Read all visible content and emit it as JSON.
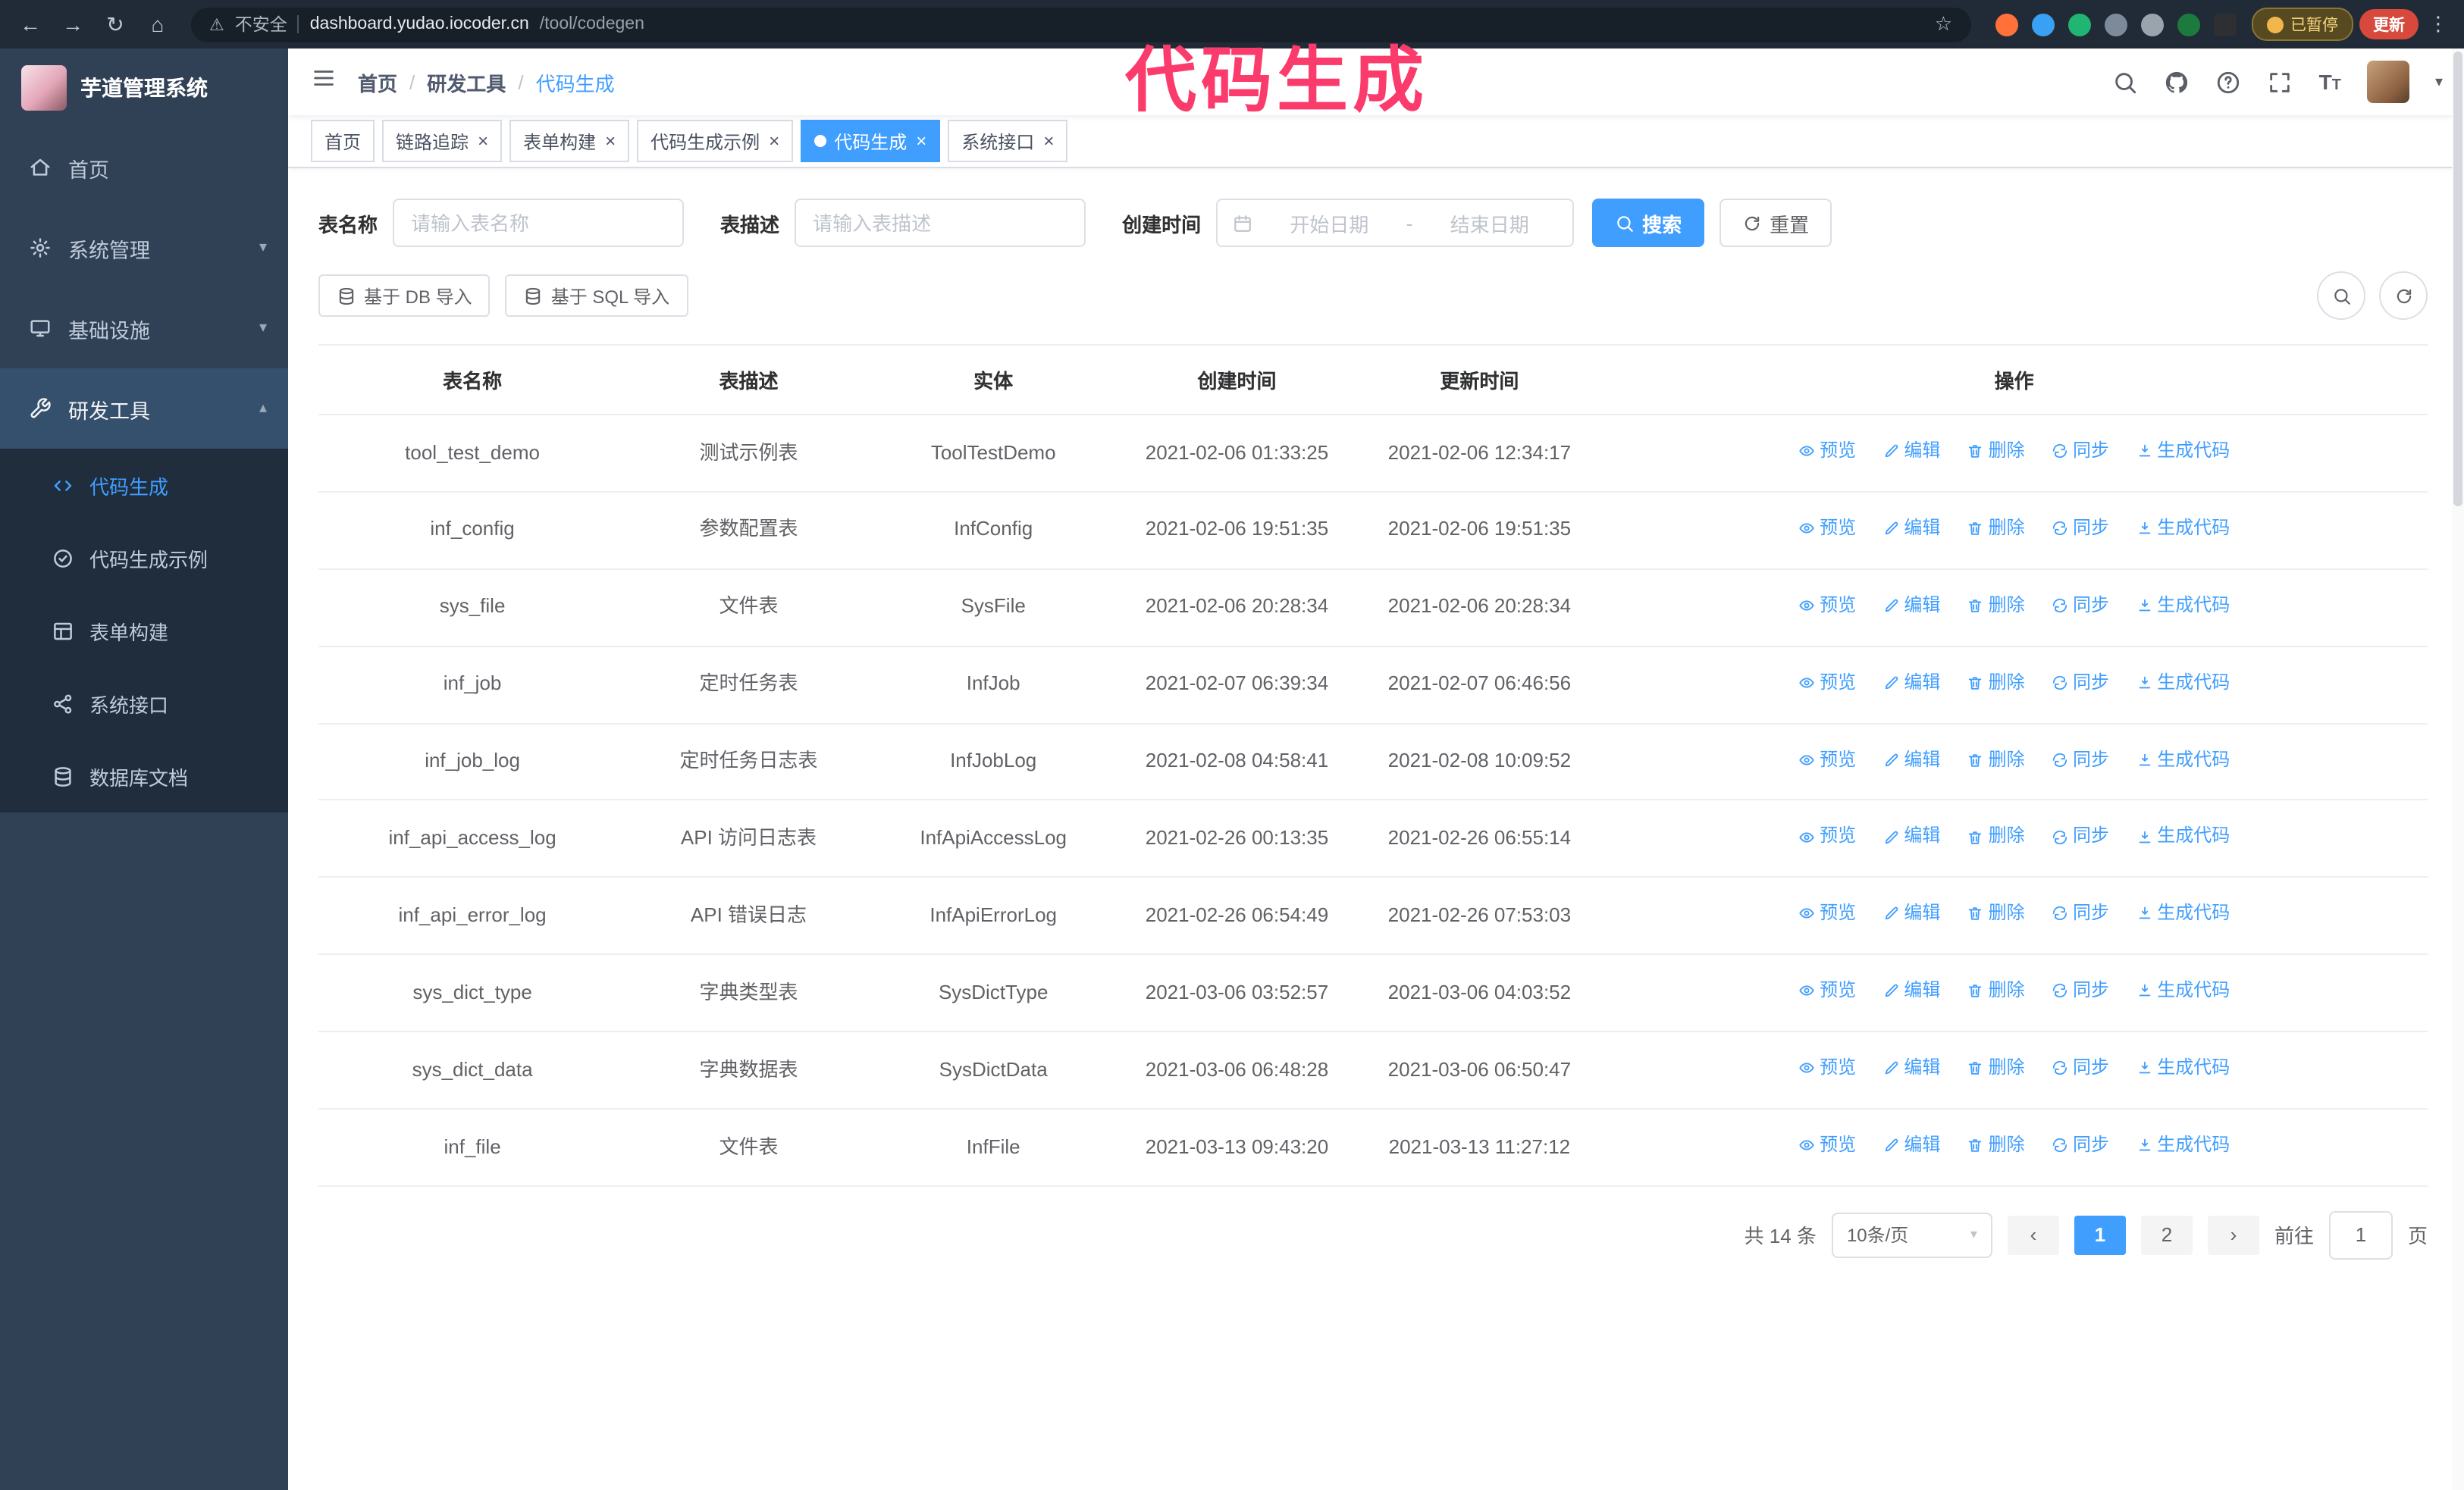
{
  "annotation": {
    "text": "代码生成"
  },
  "colors": {
    "primary": "#409eff",
    "annotation_pink": "#fb3b6c",
    "sidebar_bg": "#304156",
    "submenu_bg": "#1f2d3d"
  },
  "ui": {
    "close_glyph": "×",
    "chevron_down": "▾",
    "chevron_up": "▴",
    "caret_down": "▾",
    "font_icon_large": "T",
    "font_icon_small": "T"
  },
  "browser": {
    "back_glyph": "←",
    "forward_glyph": "→",
    "reload_glyph": "↻",
    "home_glyph": "⌂",
    "warning_glyph": "⚠",
    "security_label": "不安全",
    "url_host": "dashboard.yudao.iocoder.cn",
    "url_path": "/tool/codegen",
    "star_glyph": "☆",
    "paused_badge": "已暂停",
    "update_button": "更新",
    "overflow_glyph": "⋮"
  },
  "sidebar": {
    "logo_title": "芋道管理系统",
    "items": [
      {
        "label": "首页"
      },
      {
        "label": "系统管理"
      },
      {
        "label": "基础设施"
      },
      {
        "label": "研发工具"
      }
    ],
    "submenu": [
      {
        "label": "代码生成"
      },
      {
        "label": "代码生成示例"
      },
      {
        "label": "表单构建"
      },
      {
        "label": "系统接口"
      },
      {
        "label": "数据库文档"
      }
    ]
  },
  "header": {
    "breadcrumb": [
      "首页",
      "研发工具",
      "代码生成"
    ],
    "separator": "/"
  },
  "tabs": [
    {
      "label": "首页"
    },
    {
      "label": "链路追踪"
    },
    {
      "label": "表单构建"
    },
    {
      "label": "代码生成示例"
    },
    {
      "label": "代码生成"
    },
    {
      "label": "系统接口"
    }
  ],
  "filters": {
    "table_name_label": "表名称",
    "table_name_placeholder": "请输入表名称",
    "table_desc_label": "表描述",
    "table_desc_placeholder": "请输入表描述",
    "create_time_label": "创建时间",
    "date_start_placeholder": "开始日期",
    "date_separator": "-",
    "date_end_placeholder": "结束日期",
    "search_button": "搜索",
    "reset_button": "重置"
  },
  "toolbar": {
    "import_db": "基于 DB 导入",
    "import_sql": "基于 SQL 导入"
  },
  "table": {
    "columns": [
      "表名称",
      "表描述",
      "实体",
      "创建时间",
      "更新时间",
      "操作"
    ],
    "actions": [
      "预览",
      "编辑",
      "删除",
      "同步",
      "生成代码"
    ],
    "rows": [
      [
        "tool_test_demo",
        "测试示例表",
        "ToolTestDemo",
        "2021-02-06 01:33:25",
        "2021-02-06 12:34:17"
      ],
      [
        "inf_config",
        "参数配置表",
        "InfConfig",
        "2021-02-06 19:51:35",
        "2021-02-06 19:51:35"
      ],
      [
        "sys_file",
        "文件表",
        "SysFile",
        "2021-02-06 20:28:34",
        "2021-02-06 20:28:34"
      ],
      [
        "inf_job",
        "定时任务表",
        "InfJob",
        "2021-02-07 06:39:34",
        "2021-02-07 06:46:56"
      ],
      [
        "inf_job_log",
        "定时任务日志表",
        "InfJobLog",
        "2021-02-08 04:58:41",
        "2021-02-08 10:09:52"
      ],
      [
        "inf_api_access_log",
        "API 访问日志表",
        "InfApiAccessLog",
        "2021-02-26 00:13:35",
        "2021-02-26 06:55:14"
      ],
      [
        "inf_api_error_log",
        "API 错误日志",
        "InfApiErrorLog",
        "2021-02-26 06:54:49",
        "2021-02-26 07:53:03"
      ],
      [
        "sys_dict_type",
        "字典类型表",
        "SysDictType",
        "2021-03-06 03:52:57",
        "2021-03-06 04:03:52"
      ],
      [
        "sys_dict_data",
        "字典数据表",
        "SysDictData",
        "2021-03-06 06:48:28",
        "2021-03-06 06:50:47"
      ],
      [
        "inf_file",
        "文件表",
        "InfFile",
        "2021-03-13 09:43:20",
        "2021-03-13 11:27:12"
      ]
    ]
  },
  "pagination": {
    "total": "共 14 条",
    "page_size": "10条/页",
    "prev_glyph": "‹",
    "next_glyph": "›",
    "pages": [
      "1",
      "2"
    ],
    "goto_label": "前往",
    "goto_value": "1",
    "goto_suffix": "页"
  }
}
